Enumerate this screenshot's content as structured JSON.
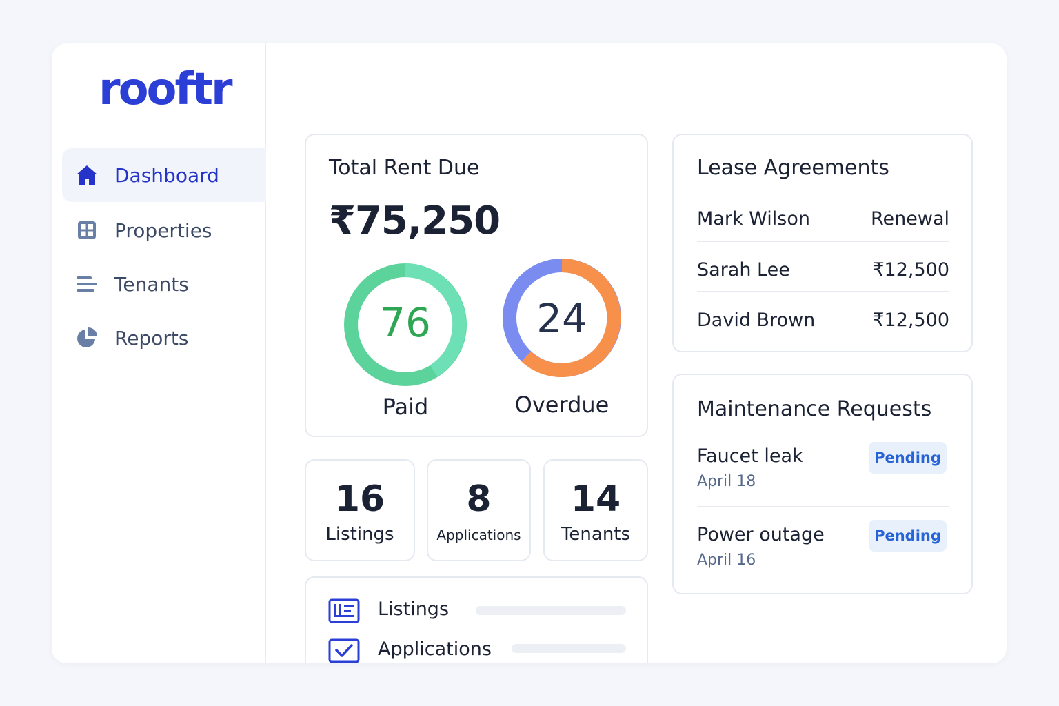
{
  "brand": {
    "logo_text": "rooftr",
    "accent": "#2b3fd6"
  },
  "sidebar": {
    "items": [
      {
        "label": "Dashboard",
        "icon": "home-icon",
        "active": true
      },
      {
        "label": "Properties",
        "icon": "grid-icon",
        "active": false
      },
      {
        "label": "Tenants",
        "icon": "list-icon",
        "active": false
      },
      {
        "label": "Reports",
        "icon": "pie-chart-icon",
        "active": false
      }
    ]
  },
  "rent_card": {
    "title": "Total Rent Due",
    "amount": "₹75,250",
    "paid": {
      "value": "76",
      "label": "Paid",
      "color": "#3ecf8e"
    },
    "overdue": {
      "value": "24",
      "label": "Overdue",
      "colors": {
        "orange": "#f7904a",
        "blue": "#7b8cf0"
      }
    }
  },
  "stats": [
    {
      "number": "16",
      "label": "Listings"
    },
    {
      "number": "8",
      "label": "Applications"
    },
    {
      "number": "14",
      "label": "Tenants"
    }
  ],
  "progress": [
    {
      "label": "Listings",
      "icon": "newspaper-icon"
    },
    {
      "label": "Applications",
      "icon": "checkbox-icon"
    }
  ],
  "lease": {
    "title": "Lease Agreements",
    "rows": [
      {
        "name": "Mark Wilson",
        "value": "Renewal"
      },
      {
        "name": "Sarah Lee",
        "value": "₹12,500"
      },
      {
        "name": "David Brown",
        "value": "₹12,500"
      }
    ]
  },
  "maintenance": {
    "title": "Maintenance Requests",
    "items": [
      {
        "title": "Faucet leak",
        "date": "April 18",
        "status": "Pending"
      },
      {
        "title": "Power outage",
        "date": "April 16",
        "status": "Pending"
      }
    ]
  }
}
